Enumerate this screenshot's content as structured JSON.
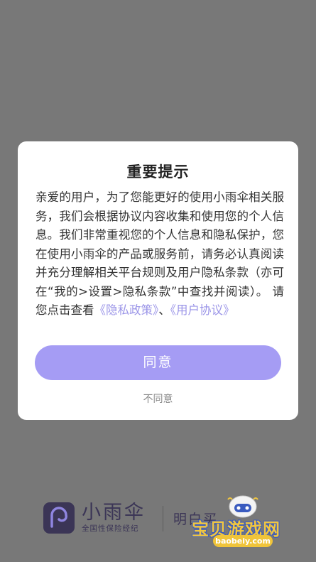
{
  "dialog": {
    "title": "重要提示",
    "body_text": "亲爱的用户，为了您能更好的使用小雨伞相关服务，我们会根据协议内容收集和使用您的个人信息。我们非常重视您的个人信息和隐私保护，您在使用小雨伞的产品或服务前，请务必认真阅读并充分理解相关平台规则及用户隐私条款（亦可在“我的>设置>隐私条款”中查找并阅读）。 请您点击查看",
    "privacy_link": "《隐私政策》",
    "separator": "、",
    "user_agreement_link": "《用户协议》",
    "agree_label": "同意",
    "disagree_label": "不同意"
  },
  "brand": {
    "name": "小雨伞",
    "subtitle": "全国性保险经纪",
    "slogan": "明白买"
  },
  "watermark": {
    "title": "宝贝游戏网",
    "url": "baobeiy.com"
  },
  "colors": {
    "overlay": "#787878",
    "accent": "#a59cf4",
    "link": "#9b95e8",
    "brand": "#3b3556"
  },
  "icons": {
    "brand_logo": "umbrella-logo-icon",
    "mascot": "game-mascot-icon"
  }
}
